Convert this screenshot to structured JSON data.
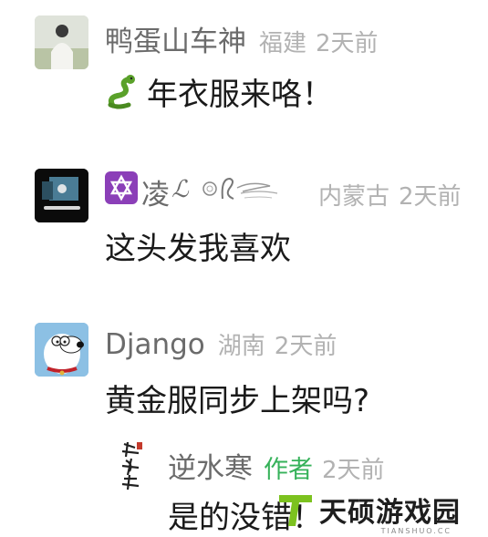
{
  "comments": [
    {
      "username": "鸭蛋山车神",
      "region": "福建",
      "time": "2天前",
      "content": "年衣服来咯！",
      "content_emoji": "snake-emoji"
    },
    {
      "username": "凌",
      "region": "内蒙古",
      "time": "2天前",
      "content": "这头发我喜欢",
      "name_prefix_icon": "six-pointed-star-badge"
    },
    {
      "username": "Django",
      "region": "湖南",
      "time": "2天前",
      "content": "黄金服同步上架吗?"
    }
  ],
  "reply": {
    "username": "逆水寒",
    "author_label": "作者",
    "time": "2天前",
    "content": "是的没错！"
  },
  "watermark": {
    "brand": "天硕游戏园",
    "sub": "TIANSHUO.CC",
    "accent_color": "#7cc21f"
  },
  "colors": {
    "username": "#6b6b6b",
    "meta": "#b2b2b2",
    "author": "#36b25a",
    "content": "#1a1a1a"
  }
}
